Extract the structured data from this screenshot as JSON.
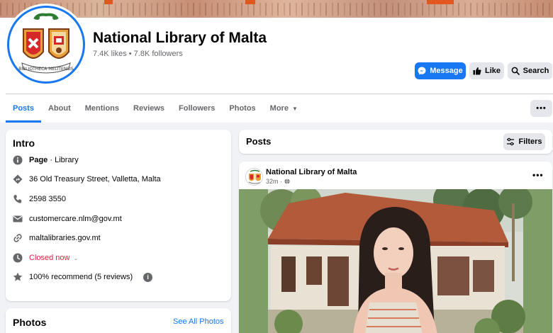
{
  "page": {
    "name": "National Library of Malta",
    "stats": "7.4K likes • 7.8K followers",
    "logo_text": "BIBLIOTHECA MELITENSIS"
  },
  "actions": {
    "message": "Message",
    "like": "Like",
    "search": "Search",
    "more": "•••"
  },
  "tabs": [
    {
      "label": "Posts",
      "active": true
    },
    {
      "label": "About"
    },
    {
      "label": "Mentions"
    },
    {
      "label": "Reviews"
    },
    {
      "label": "Followers"
    },
    {
      "label": "Photos"
    },
    {
      "label": "More",
      "caret": "▼"
    }
  ],
  "intro": {
    "title": "Intro",
    "category_strong": "Page",
    "category_rest": " · Library",
    "address": "36 Old Treasury Street, Valletta, Malta",
    "phone": "2598 3550",
    "email": "customercare.nlm@gov.mt",
    "website": "maltalibraries.gov.mt",
    "hours": "Closed now",
    "hours_caret": "⌄",
    "recommend": "100% recommend (5 reviews)",
    "info": "i"
  },
  "photos": {
    "title": "Photos",
    "see_all": "See All Photos"
  },
  "posts": {
    "title": "Posts",
    "filters": "Filters",
    "items": [
      {
        "author": "National Library of Malta",
        "time": "32m ·",
        "menu": "•••"
      }
    ]
  },
  "colors": {
    "accent": "#1877f2",
    "closed": "#e41e3f",
    "muted": "#65676b",
    "button_grey": "#e4e6eb"
  }
}
